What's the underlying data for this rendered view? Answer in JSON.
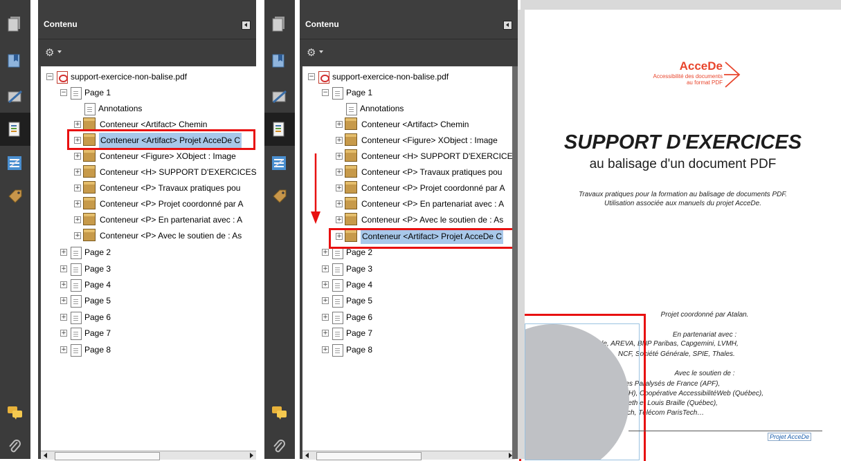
{
  "left_pane": {
    "panel_title": "Contenu",
    "tree": {
      "file": "support-exercice-non-balise.pdf",
      "page1": "Page 1",
      "annotations": "Annotations",
      "containers": [
        "Conteneur <Artifact> Chemin",
        "Conteneur <Artifact> Projet AcceDe C",
        "Conteneur <Figure> XObject :  Image",
        "Conteneur <H> SUPPORT D'EXERCICES",
        "Conteneur <P> Travaux pratiques pou",
        "Conteneur <P> Projet coordonné par A",
        "Conteneur <P> En partenariat avec : A",
        "Conteneur <P> Avec le soutien de : As"
      ],
      "pages": [
        "Page 2",
        "Page 3",
        "Page 4",
        "Page 5",
        "Page 6",
        "Page 7",
        "Page 8"
      ]
    }
  },
  "right_pane": {
    "panel_title": "Contenu",
    "tree": {
      "file": "support-exercice-non-balise.pdf",
      "page1": "Page 1",
      "annotations": "Annotations",
      "containers": [
        "Conteneur <Artifact> Chemin",
        "Conteneur <Figure> XObject :  Image",
        "Conteneur <H> SUPPORT D'EXERCICES",
        "Conteneur <P> Travaux pratiques pou",
        "Conteneur <P> Projet coordonné par A",
        "Conteneur <P> En partenariat avec : A",
        "Conteneur <P> Avec le soutien de : As",
        "Conteneur <Artifact> Projet AcceDe C"
      ],
      "pages": [
        "Page 2",
        "Page 3",
        "Page 4",
        "Page 5",
        "Page 6",
        "Page 7",
        "Page 8"
      ]
    }
  },
  "document": {
    "logo_name": "AcceDe",
    "logo_tagline1": "Accessibilité des documents",
    "logo_tagline2": "au format PDF",
    "title": "SUPPORT D'EXERCICES",
    "subtitle": "au balisage d'un document PDF",
    "intro1": "Travaux pratiques pour la formation au balisage de documents PDF.",
    "intro2": "Utilisation associée aux manuels du projet AcceDe.",
    "coord": "Projet coordonné par Atalan.",
    "partners_head": "En partenariat avec :",
    "partners1": "uide, AREVA, BNP Paribas, Capgemini, LVMH,",
    "partners2": "NCF, Société Générale, SPIE, Thales.",
    "support_head": "Avec le soutien de :",
    "support1": "on des Paralysés de France (APF),",
    "support2": "y (AVH), Coopérative AccessibilitéWeb (Québec),",
    "support3": "azareth et Louis Braille (Québec),",
    "support4": "isTech, Télécom ParisTech…",
    "footer_tag": "Projet AcceDe"
  },
  "colors": {
    "accent_red": "#e8452c",
    "highlight_red": "#e81010",
    "selection": "#a8c8ea",
    "panel_dark": "#414141"
  },
  "icons": {
    "toolbar": [
      "pages-icon",
      "bookmarks-icon",
      "signatures-icon",
      "content-icon",
      "order-icon",
      "tags-icon",
      "comments-icon",
      "attachments-icon"
    ],
    "options": "gear-icon"
  }
}
